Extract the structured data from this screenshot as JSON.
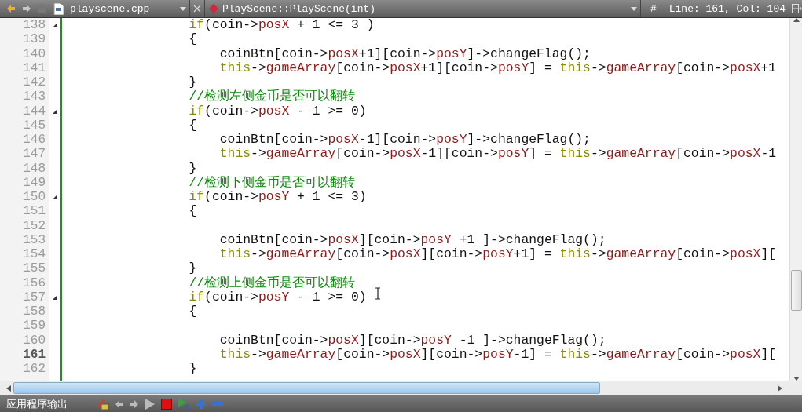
{
  "toolbar": {
    "file_name": "playscene.cpp",
    "function_name": "PlayScene::PlayScene(int)",
    "hash": "#",
    "position": "Line: 161, Col: 104"
  },
  "editor": {
    "lines": [
      {
        "number": "138",
        "fold": true,
        "current": false,
        "tokens": [
          {
            "text": "                if",
            "kind": "keyword"
          },
          {
            "text": "(coin->",
            "kind": "plain"
          },
          {
            "text": "posX",
            "kind": "member"
          },
          {
            "text": " + 1 <= 3 )",
            "kind": "plain"
          }
        ]
      },
      {
        "number": "139",
        "fold": false,
        "current": false,
        "tokens": [
          {
            "text": "                {",
            "kind": "plain"
          }
        ]
      },
      {
        "number": "140",
        "fold": false,
        "current": false,
        "tokens": [
          {
            "text": "                    coinBtn[coin->",
            "kind": "plain"
          },
          {
            "text": "posX",
            "kind": "member"
          },
          {
            "text": "+1][coin->",
            "kind": "plain"
          },
          {
            "text": "posY",
            "kind": "member"
          },
          {
            "text": "]->changeFlag();",
            "kind": "plain"
          }
        ]
      },
      {
        "number": "141",
        "fold": false,
        "current": false,
        "tokens": [
          {
            "text": "                    this",
            "kind": "keyword"
          },
          {
            "text": "->",
            "kind": "plain"
          },
          {
            "text": "gameArray",
            "kind": "member"
          },
          {
            "text": "[coin->",
            "kind": "plain"
          },
          {
            "text": "posX",
            "kind": "member"
          },
          {
            "text": "+1][coin->",
            "kind": "plain"
          },
          {
            "text": "posY",
            "kind": "member"
          },
          {
            "text": "] = ",
            "kind": "plain"
          },
          {
            "text": "this",
            "kind": "keyword"
          },
          {
            "text": "->",
            "kind": "plain"
          },
          {
            "text": "gameArray",
            "kind": "member"
          },
          {
            "text": "[coin->",
            "kind": "plain"
          },
          {
            "text": "posX",
            "kind": "member"
          },
          {
            "text": "+1",
            "kind": "plain"
          }
        ]
      },
      {
        "number": "142",
        "fold": false,
        "current": false,
        "tokens": [
          {
            "text": "                }",
            "kind": "plain"
          }
        ]
      },
      {
        "number": "143",
        "fold": false,
        "current": false,
        "tokens": [
          {
            "text": "                //检测左侧金币是否可以翻转",
            "kind": "comment"
          }
        ]
      },
      {
        "number": "144",
        "fold": true,
        "current": false,
        "tokens": [
          {
            "text": "                if",
            "kind": "keyword"
          },
          {
            "text": "(coin->",
            "kind": "plain"
          },
          {
            "text": "posX",
            "kind": "member"
          },
          {
            "text": " - 1 >= 0)",
            "kind": "plain"
          }
        ]
      },
      {
        "number": "145",
        "fold": false,
        "current": false,
        "tokens": [
          {
            "text": "                {",
            "kind": "plain"
          }
        ]
      },
      {
        "number": "146",
        "fold": false,
        "current": false,
        "tokens": [
          {
            "text": "                    coinBtn[coin->",
            "kind": "plain"
          },
          {
            "text": "posX",
            "kind": "member"
          },
          {
            "text": "-1][coin->",
            "kind": "plain"
          },
          {
            "text": "posY",
            "kind": "member"
          },
          {
            "text": "]->changeFlag();",
            "kind": "plain"
          }
        ]
      },
      {
        "number": "147",
        "fold": false,
        "current": false,
        "tokens": [
          {
            "text": "                    this",
            "kind": "keyword"
          },
          {
            "text": "->",
            "kind": "plain"
          },
          {
            "text": "gameArray",
            "kind": "member"
          },
          {
            "text": "[coin->",
            "kind": "plain"
          },
          {
            "text": "posX",
            "kind": "member"
          },
          {
            "text": "-1][coin->",
            "kind": "plain"
          },
          {
            "text": "posY",
            "kind": "member"
          },
          {
            "text": "] = ",
            "kind": "plain"
          },
          {
            "text": "this",
            "kind": "keyword"
          },
          {
            "text": "->",
            "kind": "plain"
          },
          {
            "text": "gameArray",
            "kind": "member"
          },
          {
            "text": "[coin->",
            "kind": "plain"
          },
          {
            "text": "posX",
            "kind": "member"
          },
          {
            "text": "-1",
            "kind": "plain"
          }
        ]
      },
      {
        "number": "148",
        "fold": false,
        "current": false,
        "tokens": [
          {
            "text": "                }",
            "kind": "plain"
          }
        ]
      },
      {
        "number": "149",
        "fold": false,
        "current": false,
        "tokens": [
          {
            "text": "                //检测下侧金币是否可以翻转",
            "kind": "comment"
          }
        ]
      },
      {
        "number": "150",
        "fold": true,
        "current": false,
        "tokens": [
          {
            "text": "                if",
            "kind": "keyword"
          },
          {
            "text": "(coin->",
            "kind": "plain"
          },
          {
            "text": "posY",
            "kind": "member"
          },
          {
            "text": " + 1 <= 3)",
            "kind": "plain"
          }
        ]
      },
      {
        "number": "151",
        "fold": false,
        "current": false,
        "tokens": [
          {
            "text": "                {",
            "kind": "plain"
          }
        ]
      },
      {
        "number": "152",
        "fold": false,
        "current": false
      },
      {
        "number": "153",
        "fold": false,
        "current": false,
        "tokens": [
          {
            "text": "                    coinBtn[coin->",
            "kind": "plain"
          },
          {
            "text": "posX",
            "kind": "member"
          },
          {
            "text": "][coin->",
            "kind": "plain"
          },
          {
            "text": "posY",
            "kind": "member"
          },
          {
            "text": " +1 ]->changeFlag();",
            "kind": "plain"
          }
        ]
      },
      {
        "number": "154",
        "fold": false,
        "current": false,
        "tokens": [
          {
            "text": "                    this",
            "kind": "keyword"
          },
          {
            "text": "->",
            "kind": "plain"
          },
          {
            "text": "gameArray",
            "kind": "member"
          },
          {
            "text": "[coin->",
            "kind": "plain"
          },
          {
            "text": "posX",
            "kind": "member"
          },
          {
            "text": "][coin->",
            "kind": "plain"
          },
          {
            "text": "posY",
            "kind": "member"
          },
          {
            "text": "+1] = ",
            "kind": "plain"
          },
          {
            "text": "this",
            "kind": "keyword"
          },
          {
            "text": "->",
            "kind": "plain"
          },
          {
            "text": "gameArray",
            "kind": "member"
          },
          {
            "text": "[coin->",
            "kind": "plain"
          },
          {
            "text": "posX",
            "kind": "member"
          },
          {
            "text": "][",
            "kind": "plain"
          }
        ]
      },
      {
        "number": "155",
        "fold": false,
        "current": false,
        "tokens": [
          {
            "text": "                }",
            "kind": "plain"
          }
        ]
      },
      {
        "number": "156",
        "fold": false,
        "current": false,
        "tokens": [
          {
            "text": "                //检测上侧金币是否可以翻转",
            "kind": "comment"
          }
        ]
      },
      {
        "number": "157",
        "fold": true,
        "current": false,
        "tokens": [
          {
            "text": "                if",
            "kind": "keyword"
          },
          {
            "text": "(coin->",
            "kind": "plain"
          },
          {
            "text": "posY",
            "kind": "member"
          },
          {
            "text": " - 1 >= 0)",
            "kind": "plain"
          }
        ]
      },
      {
        "number": "158",
        "fold": false,
        "current": false,
        "tokens": [
          {
            "text": "                {",
            "kind": "plain"
          }
        ]
      },
      {
        "number": "159",
        "fold": false,
        "current": false
      },
      {
        "number": "160",
        "fold": false,
        "current": false,
        "tokens": [
          {
            "text": "                    coinBtn[coin->",
            "kind": "plain"
          },
          {
            "text": "posX",
            "kind": "member"
          },
          {
            "text": "][coin->",
            "kind": "plain"
          },
          {
            "text": "posY",
            "kind": "member"
          },
          {
            "text": " -1 ]->changeFlag();",
            "kind": "plain"
          }
        ]
      },
      {
        "number": "161",
        "fold": false,
        "current": true,
        "tokens": [
          {
            "text": "                    this",
            "kind": "keyword"
          },
          {
            "text": "->",
            "kind": "plain"
          },
          {
            "text": "gameArray",
            "kind": "member"
          },
          {
            "text": "[coin->",
            "kind": "plain"
          },
          {
            "text": "posX",
            "kind": "member"
          },
          {
            "text": "][coin->",
            "kind": "plain"
          },
          {
            "text": "posY",
            "kind": "member"
          },
          {
            "text": "-1] = ",
            "kind": "plain"
          },
          {
            "text": "this",
            "kind": "keyword"
          },
          {
            "text": "->",
            "kind": "plain"
          },
          {
            "text": "gameArray",
            "kind": "member"
          },
          {
            "text": "[coin->",
            "kind": "plain"
          },
          {
            "text": "posX",
            "kind": "member"
          },
          {
            "text": "][",
            "kind": "plain"
          }
        ]
      },
      {
        "number": "162",
        "fold": false,
        "current": false,
        "tokens": [
          {
            "text": "                }",
            "kind": "plain"
          }
        ]
      }
    ]
  },
  "output_panel": {
    "title": "应用程序输出"
  }
}
